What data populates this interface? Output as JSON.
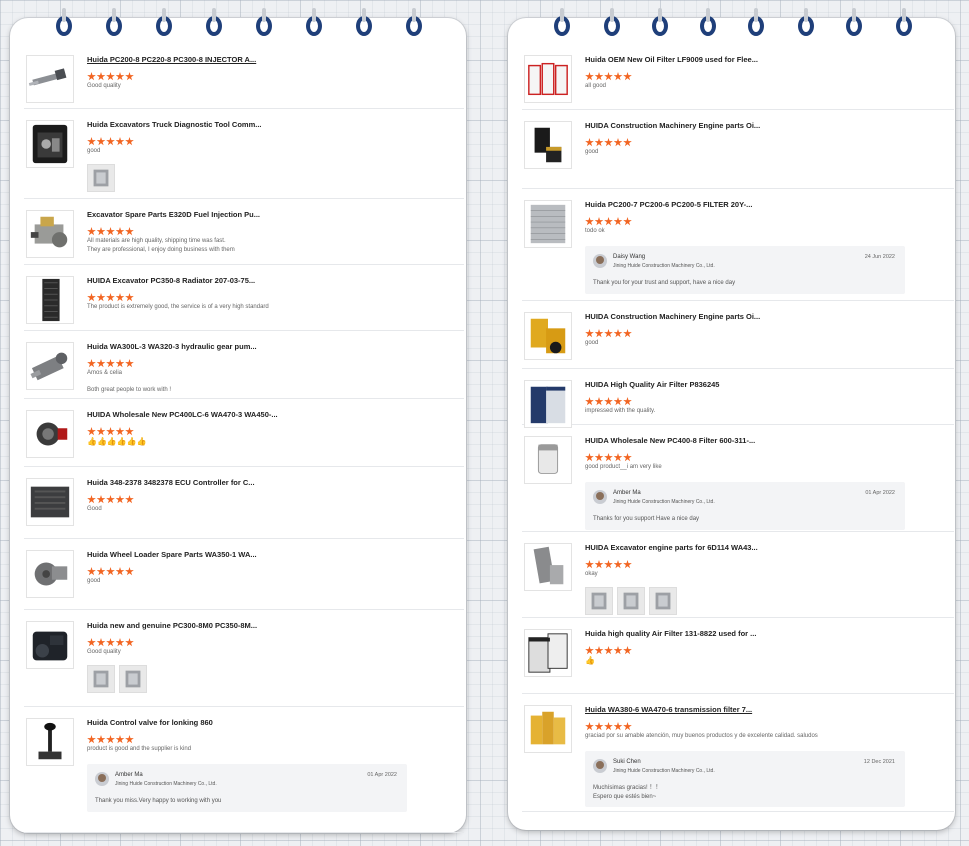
{
  "left": {
    "items": [
      {
        "title": "Huida PC200-8 PC220-8 PC300-8 INJECTOR A...",
        "underline": true,
        "review": [
          "Good quality"
        ],
        "pics": 0,
        "thumb": "injector"
      },
      {
        "title": "Huida Excavators Truck Diagnostic Tool Comm...",
        "review": [
          "good"
        ],
        "pics": 1,
        "thumb": "case"
      },
      {
        "title": "Excavator Spare Parts E320D Fuel Injection Pu...",
        "review": [
          "All materials are high quality, shipping time was fast.",
          "They are professional, I enjoy doing business with them"
        ],
        "pics": 0,
        "thumb": "pump"
      },
      {
        "title": "HUIDA Excavator PC350-8 Radiator 207-03-75...",
        "review": [
          "The product is extremely good, the service is of a very high standard"
        ],
        "pics": 0,
        "thumb": "radiator"
      },
      {
        "title": "Huida WA300L-3 WA320-3 hydraulic gear pum...",
        "review": [
          "Amos & celia",
          "",
          "Both great people to work with !"
        ],
        "pics": 0,
        "thumb": "gearpump"
      },
      {
        "title": "HUIDA Wholesale New PC400LC-6 WA470-3 WA450-...",
        "review": [],
        "emoji": "👍👍👍👍👍👍",
        "pics": 0,
        "thumb": "turbo"
      },
      {
        "title": "Huida 348-2378 3482378 ECU Controller for C...",
        "review": [
          "Good"
        ],
        "pics": 0,
        "thumb": "ecu"
      },
      {
        "title": "Huida Wheel Loader Spare Parts WA350-1 WA...",
        "review": [
          "good"
        ],
        "pics": 0,
        "thumb": "motor"
      },
      {
        "title": "Huida new and genuine PC300-8M0 PC350-8M...",
        "review": [
          "Good quality"
        ],
        "pics": 2,
        "thumb": "bigpump"
      },
      {
        "title": "Huida Control valve for lonking 860",
        "review": [
          "product is good and the supplier is kind"
        ],
        "pics": 0,
        "thumb": "joystick",
        "reply": {
          "name": "Amber Ma",
          "company": "Jining Huide Construction Machinery Co., Ltd.",
          "date": "01 Apr 2022",
          "msg": [
            "Thank you miss.Very happy to working with you"
          ]
        }
      }
    ]
  },
  "right": {
    "items": [
      {
        "title": "Huida OEM New Oil Filter LF9009 used for Flee...",
        "review": [
          "all good"
        ],
        "pics": 0,
        "thumb": "filters3"
      },
      {
        "title": "HUIDA Construction Machinery Engine parts Oi...",
        "review": [
          "good"
        ],
        "pics": 0,
        "thumb": "filters2"
      },
      {
        "title": "Huida PC200-7 PC200-6 PC200-5 FILTER 20Y-...",
        "review": [
          "todo ok"
        ],
        "pics": 0,
        "thumb": "mesh",
        "reply": {
          "name": "Daisy Wang",
          "company": "Jining Huide Construction Machinery Co., Ltd.",
          "date": "24 Jun 2022",
          "msg": [
            "Thank you for your trust and support, have a nice day"
          ]
        }
      },
      {
        "title": "HUIDA Construction Machinery Engine parts Oi...",
        "review": [
          "good"
        ],
        "pics": 0,
        "thumb": "cat"
      },
      {
        "title": "HUIDA High Quality Air Filter P836245",
        "review": [
          "impressed with the quality."
        ],
        "pics": 0,
        "thumb": "airfilter"
      },
      {
        "title": "HUIDA Wholesale New PC400-8 Filter 600-311-...",
        "review": [
          "good product__i am very like"
        ],
        "pics": 0,
        "thumb": "smallfilter",
        "reply": {
          "name": "Amber Ma",
          "company": "Jining Huide Construction Machinery Co., Ltd.",
          "date": "01 Apr 2022",
          "msg": [
            "Thanks for you support   Have a nice day"
          ]
        }
      },
      {
        "title": "HUIDA Excavator engine parts for 6D114 WA43...",
        "review": [
          "okay"
        ],
        "pics": 3,
        "thumb": "sleeve"
      },
      {
        "title": "Huida high quality Air Filter 131-8822 used for ...",
        "review": [],
        "emoji": "👍",
        "pics": 0,
        "thumb": "bigair"
      },
      {
        "title": "Huida WA380-6 WA470-6 transmission filter 7...",
        "underline": true,
        "review": [
          "graciad por su amable atención, muy buenos productos y de excelente calidad. saludos"
        ],
        "pics": 0,
        "thumb": "yellowfilters",
        "reply": {
          "name": "Suki Chen",
          "company": "Jining Huide Construction Machinery Co., Ltd.",
          "date": "12 Dec 2021",
          "msg": [
            "Muchísimas gracias! ！！",
            "Espero que estés bien~"
          ]
        }
      }
    ]
  },
  "colors": {
    "star": "#f26522",
    "ring": "#1f3f7a",
    "reply_bg": "#f3f4f6"
  }
}
